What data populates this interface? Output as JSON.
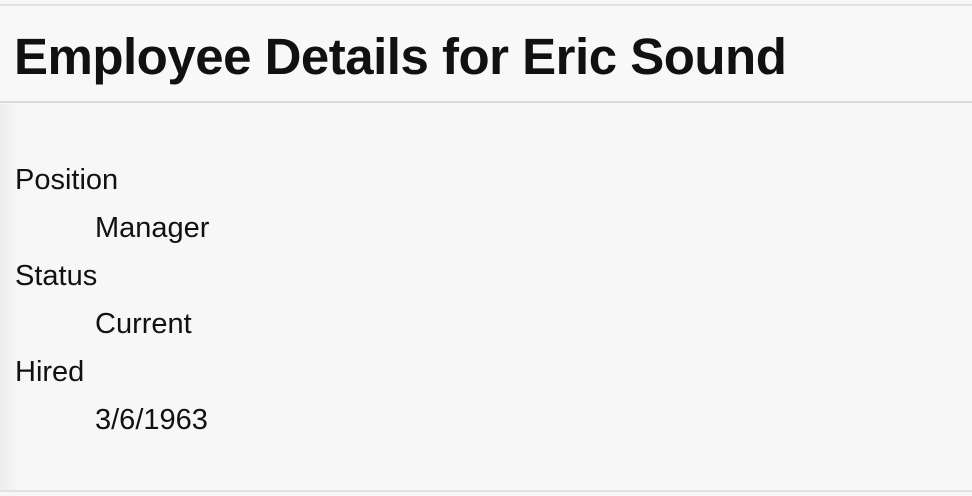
{
  "header": {
    "title": "Employee Details for Eric Sound"
  },
  "details": [
    {
      "label": "Position",
      "value": "Manager"
    },
    {
      "label": "Status",
      "value": "Current"
    },
    {
      "label": "Hired",
      "value": "3/6/1963"
    }
  ]
}
